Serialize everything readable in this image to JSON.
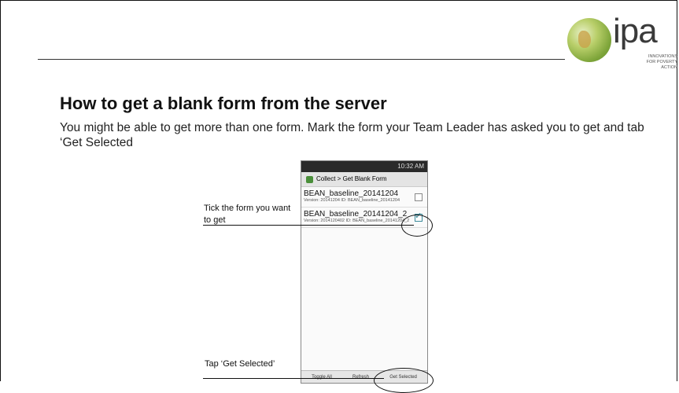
{
  "header": {
    "title": "How to get a blank form from the server",
    "subtitle": "You might be able to get more than one form. Mark the form your Team Leader has asked you to get and tab ‘Get Selected"
  },
  "logo": {
    "text": "ipa",
    "tagline": "INNOVATIONS FOR POVERTY ACTION",
    "icon": "globe-icon"
  },
  "phone": {
    "status": {
      "left": "",
      "right": "10:32 AM"
    },
    "appbar": {
      "title": "Collect > Get Blank Form"
    },
    "forms": [
      {
        "name": "BEAN_baseline_20141204",
        "meta": "Version: 20141204 ID: BEAN_baseline_20141204",
        "checked": false
      },
      {
        "name": "BEAN_baseline_20141204_2",
        "meta": "Version: 2014120402 ID: BEAN_baseline_20141204_2",
        "checked": true
      }
    ],
    "buttons": {
      "toggle": "Toggle All",
      "refresh": "Refresh",
      "get_selected": "Get Selected"
    }
  },
  "annotations": {
    "tick": "Tick the form you want to get",
    "tap": "Tap ‘Get Selected’"
  }
}
